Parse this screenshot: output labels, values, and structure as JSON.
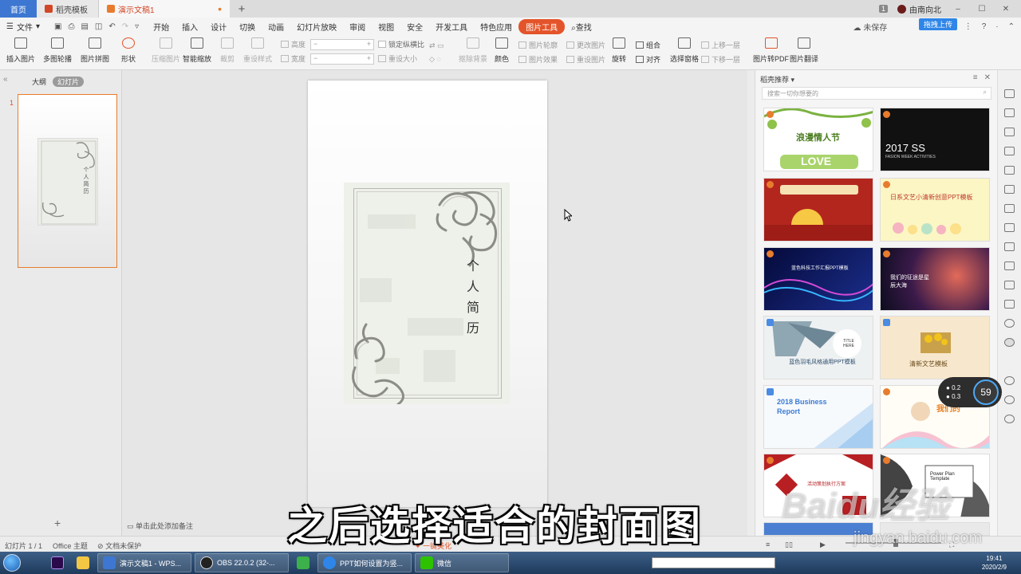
{
  "window": {
    "tabs": [
      {
        "label": "首页"
      },
      {
        "label": "稻壳模板"
      },
      {
        "label": "演示文稿1"
      }
    ],
    "badge": "1",
    "user": "由南向北"
  },
  "menu": {
    "file": "文件",
    "items": [
      "开始",
      "插入",
      "设计",
      "切换",
      "动画",
      "幻灯片放映",
      "审阅",
      "视图",
      "安全",
      "开发工具",
      "特色应用",
      "图片工具"
    ],
    "search": "查找",
    "unsaved": "未保存",
    "upload": "拖拽上传"
  },
  "ribbon": {
    "insert_image": "插入图片",
    "multi_contour": "多图轮播",
    "collage": "图片拼图",
    "shape": "形状",
    "compress": "压缩图片",
    "smart_zoom": "智能缩放",
    "crop": "裁剪",
    "reset_size": "重设样式",
    "height": "高度",
    "width": "宽度",
    "lock_ratio": "锁定纵横比",
    "reset_size2": "重设大小",
    "remove_bg": "抠除背景",
    "color": "颜色",
    "outline": "图片轮廓",
    "effect": "图片效果",
    "change_pic": "更改图片",
    "reset_pic": "重设图片",
    "rotate": "旋转",
    "group": "组合",
    "align": "对齐",
    "up_layer": "上移一层",
    "down_layer": "下移一层",
    "select_pane": "选择窗格",
    "to_pdf": "图片转PDF",
    "translate": "图片翻译"
  },
  "leftpane": {
    "tab_outline": "大纲",
    "tab_slides": "幻灯片",
    "slide_number": "1",
    "thumb_title": "个人简历"
  },
  "slide": {
    "title": "个人简历"
  },
  "rightpane": {
    "header": "稻壳推荐",
    "search_placeholder": "搜索一切你想要的",
    "templates": [
      {
        "text": "浪漫情人节",
        "sub": "LOVE"
      },
      {
        "text": "2017 SS",
        "sub": "FASION WEEK ACTIVITIES"
      },
      {
        "text": "",
        "sub": ""
      },
      {
        "text": "日系文艺小清新创意PPT模板",
        "sub": ""
      },
      {
        "text": "蓝色科技工作汇报PPT模板",
        "sub": ""
      },
      {
        "text": "我们的征途是星辰大海",
        "sub": ""
      },
      {
        "text": "蓝色羽毛风格通用PPT模板",
        "sub": "TITLE HERE"
      },
      {
        "text": "清新文艺模板",
        "sub": ""
      },
      {
        "text": "2018 Business Report",
        "sub": ""
      },
      {
        "text": "我们的",
        "sub": ""
      },
      {
        "text": "活动策划执行方案",
        "sub": ""
      },
      {
        "text": "Power Plan Template",
        "sub": ""
      }
    ]
  },
  "netwidget": {
    "up": "0.2",
    "down": "0.3",
    "percent": "59"
  },
  "notes": {
    "placeholder": "单击此处添加备注"
  },
  "status": {
    "slide_count": "幻灯片 1 / 1",
    "theme": "Office 主题",
    "protect": "文档未保护",
    "beautify": "一键美化"
  },
  "caption": "之后选择适合的封面图",
  "watermark": "Baidu经验",
  "watermark_url": "jingyan.baidu.com",
  "taskbar": {
    "items": [
      {
        "label": "演示文稿1 - WPS..."
      },
      {
        "label": "OBS 22.0.2 (32-..."
      },
      {
        "label": "PPT如何设置为竖..."
      },
      {
        "label": "微信"
      }
    ],
    "time": "19:41",
    "date": "2020/2/9"
  },
  "colors": {
    "accent": "#e4542a",
    "tab_home": "#3d77d1",
    "taskbar": "#1e3a5c"
  }
}
